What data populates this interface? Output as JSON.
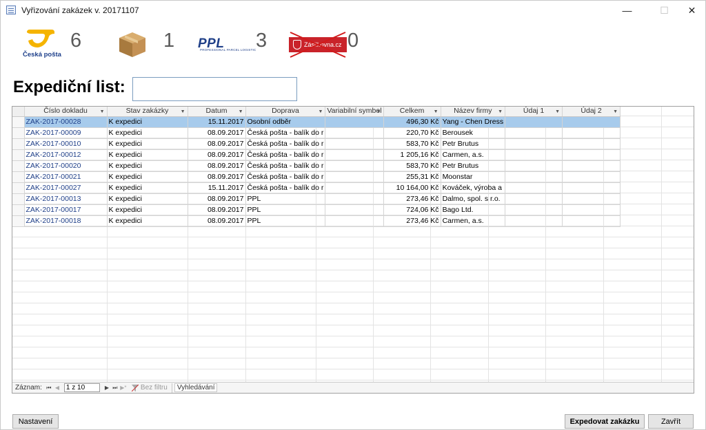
{
  "window": {
    "title": "Vyřizování zakázek v. 20171107",
    "min": "—",
    "max": "☐",
    "close": "✕"
  },
  "carriers": [
    {
      "name": "Česká pošta",
      "count": "6"
    },
    {
      "name": "box",
      "count": "1"
    },
    {
      "name": "PPL",
      "sub": "PROFESSIONAL PARCEL LOGISTIC",
      "count": "3"
    },
    {
      "name": "Zásilkovna.cz",
      "count": "0"
    }
  ],
  "expedition": {
    "label": "Expediční list:",
    "value": ""
  },
  "table": {
    "columns": [
      "Číslo dokladu",
      "Stav zakázky",
      "Datum",
      "Doprava",
      "Variabilní symbol",
      "Celkem",
      "Název firmy",
      "Údaj 1",
      "Údaj 2"
    ],
    "rows": [
      [
        "ZAK-2017-00028",
        "K expedici",
        "15.11.2017",
        "Osobní odběr",
        "",
        "496,30 Kč",
        "Yang - Chen Dress",
        "",
        ""
      ],
      [
        "ZAK-2017-00009",
        "K expedici",
        "08.09.2017",
        "Česká pošta - balík do r",
        "",
        "220,70 Kč",
        "Berousek",
        "",
        ""
      ],
      [
        "ZAK-2017-00010",
        "K expedici",
        "08.09.2017",
        "Česká pošta - balík do r",
        "",
        "583,70 Kč",
        "Petr Brutus",
        "",
        ""
      ],
      [
        "ZAK-2017-00012",
        "K expedici",
        "08.09.2017",
        "Česká pošta - balík do r",
        "",
        "1 205,16 Kč",
        "Carmen, a.s.",
        "",
        ""
      ],
      [
        "ZAK-2017-00020",
        "K expedici",
        "08.09.2017",
        "Česká pošta - balík do r",
        "",
        "583,70 Kč",
        "Petr Brutus",
        "",
        ""
      ],
      [
        "ZAK-2017-00021",
        "K expedici",
        "08.09.2017",
        "Česká pošta - balík do r",
        "",
        "255,31 Kč",
        "Moonstar",
        "",
        ""
      ],
      [
        "ZAK-2017-00027",
        "K expedici",
        "15.11.2017",
        "Česká pošta - balík do r",
        "",
        "10 164,00 Kč",
        "Kováček, výroba a",
        "",
        ""
      ],
      [
        "ZAK-2017-00013",
        "K expedici",
        "08.09.2017",
        "PPL",
        "",
        "273,46 Kč",
        "Dalmo, spol. s r.o.",
        "",
        ""
      ],
      [
        "ZAK-2017-00017",
        "K expedici",
        "08.09.2017",
        "PPL",
        "",
        "724,06 Kč",
        "Bago Ltd.",
        "",
        ""
      ],
      [
        "ZAK-2017-00018",
        "K expedici",
        "08.09.2017",
        "PPL",
        "",
        "273,46 Kč",
        "Carmen, a.s.",
        "",
        ""
      ]
    ]
  },
  "nav": {
    "label": "Záznam:",
    "first": "⏮",
    "prev": "◀",
    "position": "1 z 10",
    "next": "▶",
    "last": "⏭",
    "new": "▶*",
    "filter": "Bez filtru",
    "search": "Vyhledávání"
  },
  "buttons": {
    "settings": "Nastavení",
    "expedite": "Expedovat zakázku",
    "close": "Zavřít"
  },
  "colors": {
    "selected_row": "#a7cbec",
    "link": "#1f3f88",
    "posta": "#f5b400",
    "zasilkovna": "#c9232a"
  }
}
